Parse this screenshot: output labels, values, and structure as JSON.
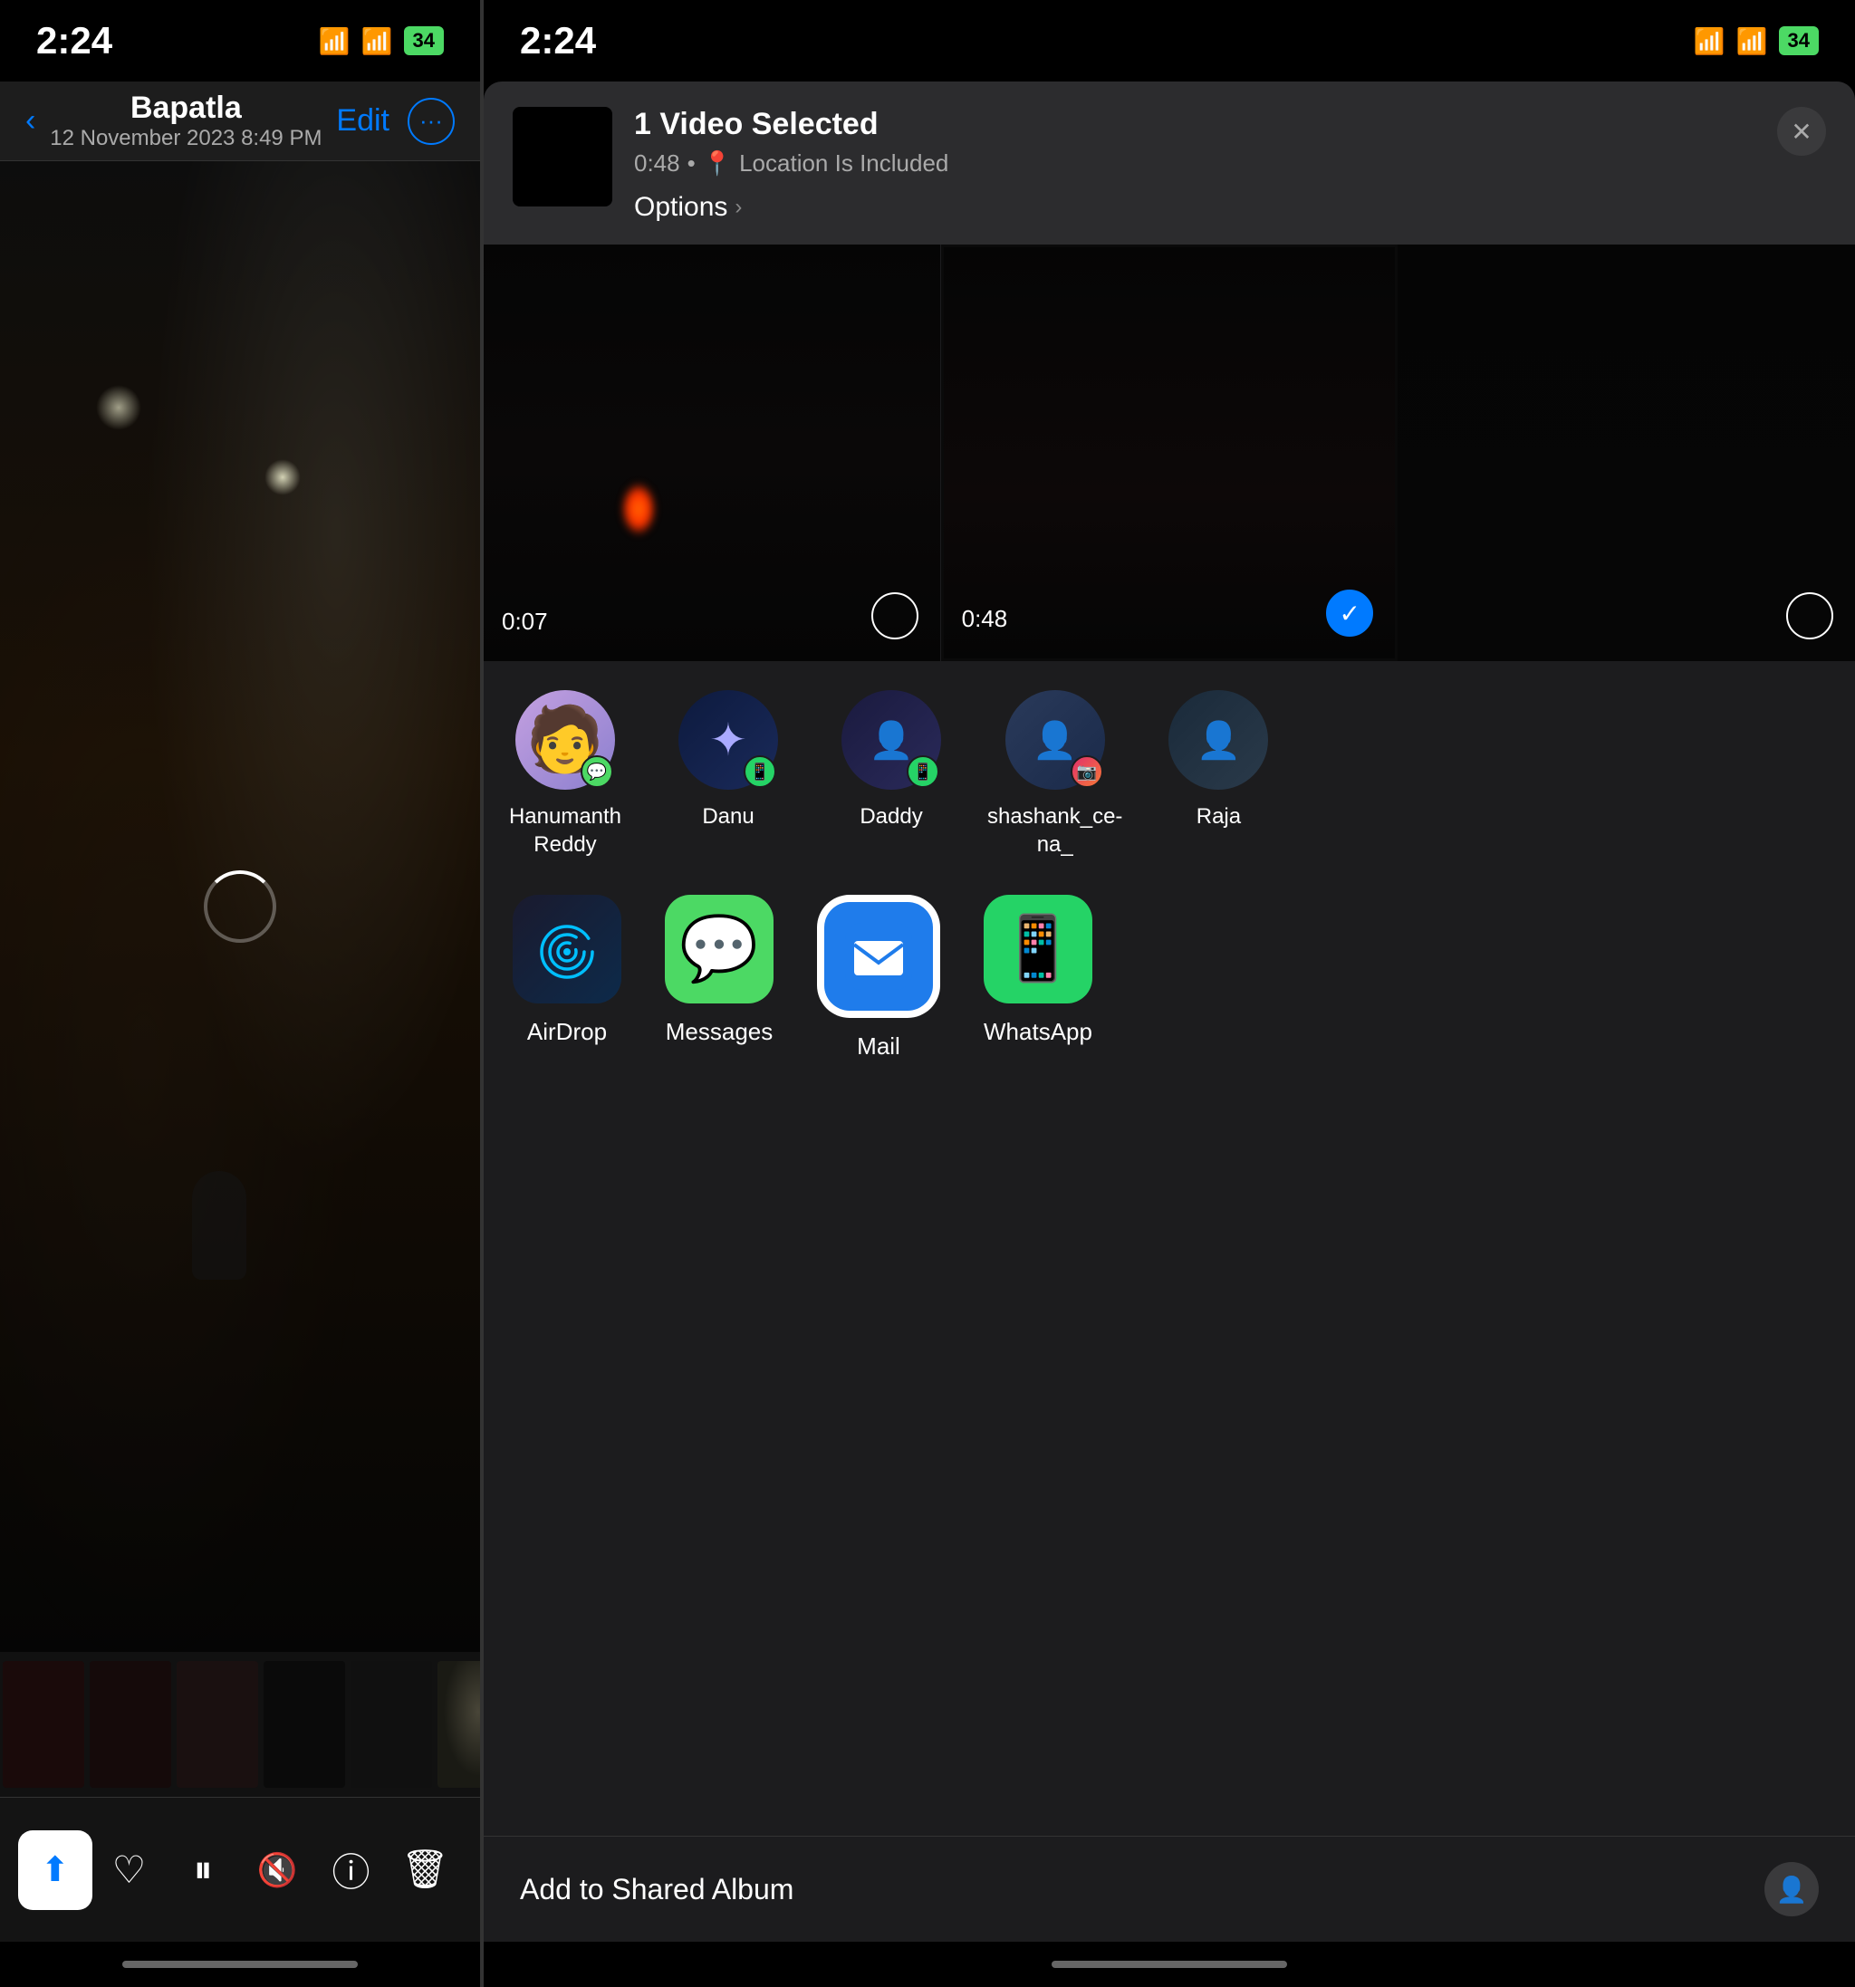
{
  "left": {
    "status": {
      "time": "2:24",
      "battery": "34"
    },
    "nav": {
      "back_label": "‹",
      "title": "Bapatla",
      "subtitle": "12 November 2023  8:49 PM",
      "edit_label": "Edit",
      "more_icon": "···"
    },
    "toolbar": {
      "share_icon": "↑",
      "heart_icon": "♡",
      "pause_icon": "⏸",
      "mute_icon": "✕",
      "info_icon": "ⓘ",
      "trash_icon": "🗑"
    }
  },
  "right": {
    "status": {
      "time": "2:24",
      "battery": "34"
    },
    "share_sheet": {
      "header": {
        "title": "1 Video Selected",
        "duration": "0:48",
        "location": "Location Is Included",
        "options_label": "Options",
        "close_icon": "✕"
      },
      "videos": [
        {
          "duration": "0:07",
          "selected": false
        },
        {
          "duration": "0:48",
          "selected": true
        },
        {
          "duration": "",
          "selected": false
        }
      ],
      "contacts": [
        {
          "name": "Hanumanth\nReddy",
          "badge": "messages"
        },
        {
          "name": "Danu",
          "badge": "whatsapp"
        },
        {
          "name": "Daddy",
          "badge": "whatsapp"
        },
        {
          "name": "shashank_ce-\nna_",
          "badge": "instagram"
        },
        {
          "name": "Raja",
          "badge": ""
        }
      ],
      "apps": [
        {
          "id": "airdrop",
          "label": "AirDrop"
        },
        {
          "id": "messages",
          "label": "Messages"
        },
        {
          "id": "mail",
          "label": "Mail"
        },
        {
          "id": "whatsapp",
          "label": "WhatsApp"
        }
      ],
      "bottom_action": {
        "label": "Add to Shared Album"
      }
    }
  }
}
